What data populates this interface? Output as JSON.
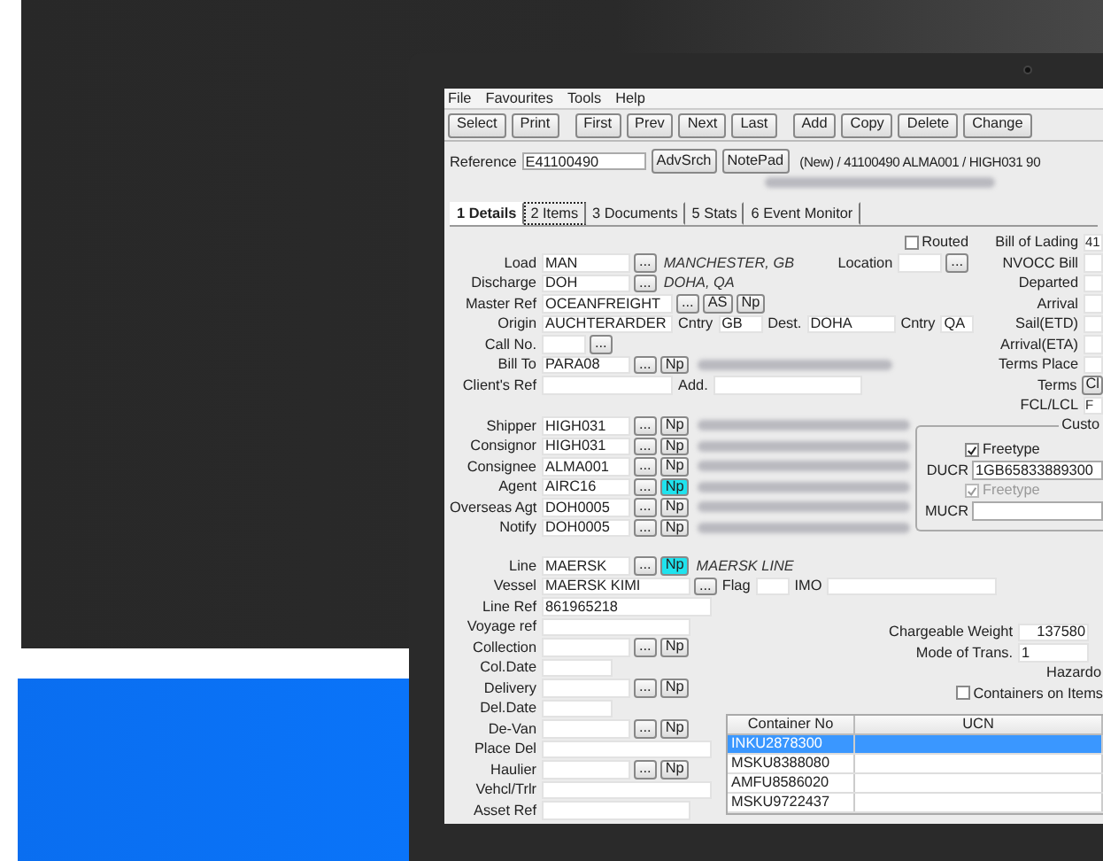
{
  "menu": [
    "File",
    "Favourites",
    "Tools",
    "Help"
  ],
  "toolbar": [
    [
      {
        "label": "Select"
      },
      {
        "label": "Print"
      }
    ],
    [
      {
        "label": "First"
      },
      {
        "label": "Prev"
      },
      {
        "label": "Next"
      },
      {
        "label": "Last"
      }
    ],
    [
      {
        "label": "Add"
      },
      {
        "label": "Copy"
      },
      {
        "label": "Delete"
      },
      {
        "label": "Change"
      }
    ]
  ],
  "reference": {
    "label": "Reference",
    "value": "E41100490",
    "buttons": [
      "AdvSrch",
      "NotePad"
    ],
    "summary": "(New) / 41100490 ALMA001 / HIGH031 90"
  },
  "tabs": [
    {
      "label": "1 Details",
      "selected": true,
      "focused": false
    },
    {
      "label": "2 Items",
      "selected": false,
      "focused": true
    },
    {
      "label": "3 Documents",
      "selected": false,
      "focused": false
    },
    {
      "label": "5 Stats",
      "selected": false,
      "focused": false
    },
    {
      "label": "6 Event Monitor",
      "selected": false,
      "focused": false
    }
  ],
  "top_rows": [
    {
      "parts": [],
      "middle": [
        {
          "kind": "checkbox",
          "label": "Routed",
          "checked": false
        }
      ],
      "right": {
        "label": "Bill of Lading",
        "value": "41"
      }
    },
    {
      "label": "Load",
      "parts": [
        {
          "kind": "codefield",
          "value": "MAN"
        },
        {
          "kind": "button",
          "text": "...",
          "highlighted": false
        },
        {
          "kind": "note",
          "text": "MANCHESTER, GB"
        }
      ],
      "middle": [
        {
          "kind": "text",
          "text": "Location"
        },
        {
          "kind": "smallfield"
        },
        {
          "kind": "button",
          "text": "...",
          "highlighted": false
        }
      ],
      "right": {
        "label": "NVOCC Bill"
      }
    },
    {
      "label": "Discharge",
      "parts": [
        {
          "kind": "codefield",
          "value": "DOH"
        },
        {
          "kind": "button",
          "text": "...",
          "highlighted": false
        },
        {
          "kind": "note",
          "text": "DOHA, QA"
        }
      ],
      "right": {
        "label": "Departed"
      }
    },
    {
      "label": "Master Ref",
      "parts": [
        {
          "kind": "midfield",
          "value": "OCEANFREIGHT"
        },
        {
          "kind": "button",
          "text": "...",
          "highlighted": false
        },
        {
          "kind": "button",
          "text": "AS",
          "highlighted": false
        },
        {
          "kind": "button",
          "text": "Np",
          "highlighted": false
        }
      ],
      "right": {
        "label": "Arrival"
      }
    },
    {
      "label": "Origin",
      "parts": [
        {
          "kind": "midfield",
          "value": "AUCHTERARDER"
        },
        {
          "kind": "text",
          "text": "Cntry"
        },
        {
          "kind": "smallfield",
          "value": "GB"
        },
        {
          "kind": "text",
          "text": "Dest."
        },
        {
          "kind": "shortfield",
          "value": "DOHA"
        },
        {
          "kind": "text",
          "text": "Cntry"
        },
        {
          "kind": "tinyfield",
          "value": "QA"
        }
      ],
      "right": {
        "label": "Sail(ETD)"
      }
    },
    {
      "label": "Call No.",
      "parts": [
        {
          "kind": "smallfield"
        },
        {
          "kind": "button",
          "text": "...",
          "highlighted": false
        }
      ],
      "right": {
        "label": "Arrival(ETA)"
      }
    },
    {
      "label": "Bill To",
      "parts": [
        {
          "kind": "codefield",
          "value": "PARA08"
        },
        {
          "kind": "button",
          "text": "...",
          "highlighted": false
        },
        {
          "kind": "button",
          "text": "Np",
          "highlighted": false
        },
        {
          "kind": "blur"
        }
      ],
      "right": {
        "label": "Terms Place"
      }
    },
    {
      "label": "Client's Ref",
      "parts": [
        {
          "kind": "midfield"
        },
        {
          "kind": "text",
          "text": "Add."
        },
        {
          "kind": "longfield"
        }
      ],
      "right": {
        "label": "Terms",
        "button": "Cl"
      }
    },
    {
      "parts": [],
      "right": {
        "label": "FCL/LCL",
        "value": "F"
      }
    }
  ],
  "parties": [
    {
      "label": "Shipper",
      "code": "HIGH031",
      "lookup": "...",
      "np": "Np",
      "highlighted": false
    },
    {
      "label": "Consignor",
      "code": "HIGH031",
      "lookup": "...",
      "np": "Np",
      "highlighted": false
    },
    {
      "label": "Consignee",
      "code": "ALMA001",
      "lookup": "...",
      "np": "Np",
      "highlighted": false
    },
    {
      "label": "Agent",
      "code": "AIRC16",
      "lookup": "...",
      "np": "Np",
      "highlighted": true
    },
    {
      "label": "Overseas Agt",
      "code": "DOH0005",
      "lookup": "...",
      "np": "Np",
      "highlighted": false
    },
    {
      "label": "Notify",
      "code": "DOH0005",
      "lookup": "...",
      "np": "Np",
      "highlighted": false
    }
  ],
  "customs": {
    "title": "Custo",
    "rows": [
      {
        "kind": "checkbox",
        "label": "Freetype",
        "checked": true,
        "disabled": false
      },
      {
        "kind": "field",
        "label": "DUCR",
        "value": "1GB65833889300"
      },
      {
        "kind": "checkbox",
        "label": "Freetype",
        "checked": true,
        "disabled": true
      },
      {
        "kind": "field",
        "label": "MUCR"
      }
    ]
  },
  "carrier_rows": [
    {
      "label": "Line",
      "parts": [
        {
          "kind": "codefield",
          "value": "MAERSK"
        },
        {
          "kind": "button",
          "text": "...",
          "highlighted": false
        },
        {
          "kind": "button",
          "text": "Np",
          "highlighted": true
        },
        {
          "kind": "note",
          "text": "MAERSK LINE"
        }
      ]
    },
    {
      "label": "Vessel",
      "parts": [
        {
          "kind": "longfield",
          "value": "MAERSK KIMI"
        },
        {
          "kind": "button",
          "text": "...",
          "highlighted": false
        },
        {
          "kind": "text",
          "text": "Flag"
        },
        {
          "kind": "tinyfield"
        },
        {
          "kind": "text",
          "text": "IMO"
        },
        {
          "kind": "widefield"
        }
      ]
    },
    {
      "label": "Line Ref",
      "parts": [
        {
          "kind": "widefield",
          "value": "861965218"
        }
      ]
    }
  ],
  "bottom_rows": [
    {
      "label": "Voyage ref",
      "parts": [
        {
          "kind": "longfield"
        }
      ]
    },
    {
      "label": "Collection",
      "parts": [
        {
          "kind": "codefield"
        },
        {
          "kind": "button",
          "text": "...",
          "highlighted": false
        },
        {
          "kind": "button",
          "text": "Np",
          "highlighted": false
        }
      ]
    },
    {
      "label": "Col.Date",
      "parts": [
        {
          "kind": "datefield"
        }
      ]
    },
    {
      "label": "Delivery",
      "parts": [
        {
          "kind": "codefield"
        },
        {
          "kind": "button",
          "text": "...",
          "highlighted": false
        },
        {
          "kind": "button",
          "text": "Np",
          "highlighted": false
        }
      ]
    },
    {
      "label": "Del.Date",
      "parts": [
        {
          "kind": "datefield"
        }
      ]
    },
    {
      "label": "De-Van",
      "parts": [
        {
          "kind": "codefield"
        },
        {
          "kind": "button",
          "text": "...",
          "highlighted": false
        },
        {
          "kind": "button",
          "text": "Np",
          "highlighted": false
        }
      ]
    },
    {
      "label": "Place Del",
      "parts": [
        {
          "kind": "widefield"
        }
      ]
    },
    {
      "label": "Haulier",
      "parts": [
        {
          "kind": "codefield"
        },
        {
          "kind": "button",
          "text": "...",
          "highlighted": false
        },
        {
          "kind": "button",
          "text": "Np",
          "highlighted": false
        }
      ]
    },
    {
      "label": "Vehcl/Trlr",
      "parts": [
        {
          "kind": "widefield"
        }
      ]
    },
    {
      "label": "Asset Ref",
      "parts": [
        {
          "kind": "longfield"
        }
      ]
    }
  ],
  "shipment": [
    {
      "kind": "field",
      "label": "Chargeable Weight",
      "value": "137580"
    },
    {
      "kind": "field",
      "label": "Mode of Trans.",
      "value": "1"
    },
    {
      "kind": "text",
      "label": "Hazardo"
    },
    {
      "kind": "checkbox",
      "label": "Containers on Items",
      "checked": false
    }
  ],
  "containers": {
    "columns": [
      "Container No",
      "UCN"
    ],
    "rows": [
      {
        "container": "INKU2878300",
        "selected": true
      },
      {
        "container": "MSKU8388080",
        "selected": false
      },
      {
        "container": "AMFU8586020",
        "selected": false
      },
      {
        "container": "MSKU9722437",
        "selected": false
      }
    ]
  }
}
